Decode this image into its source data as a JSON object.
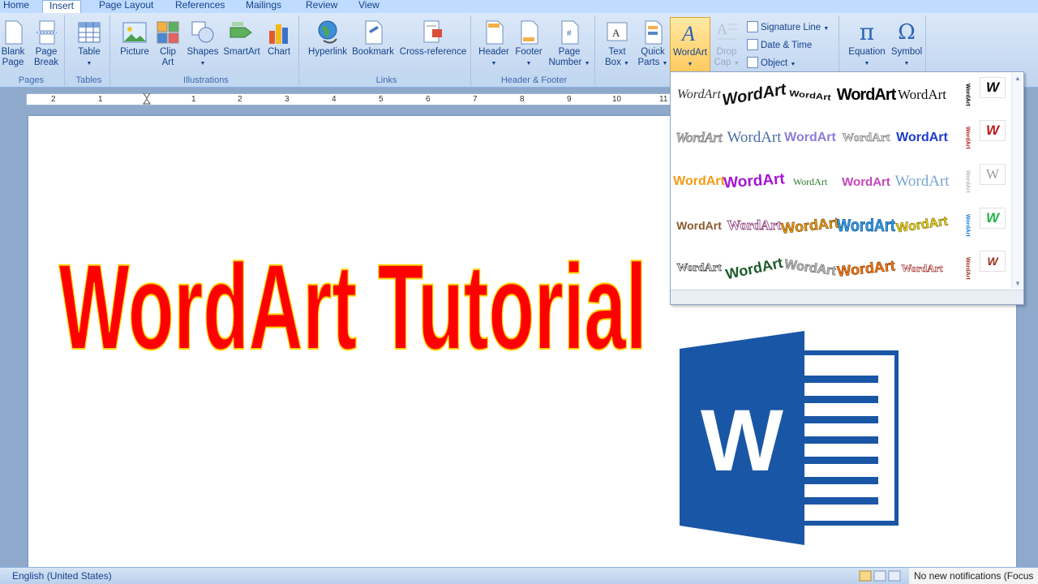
{
  "tabs": [
    "Home",
    "Insert",
    "Page Layout",
    "References",
    "Mailings",
    "Review",
    "View"
  ],
  "active_tab": "Insert",
  "groups": {
    "pages": "Pages",
    "tables": "Tables",
    "illustrations": "Illustrations",
    "links": "Links",
    "header_footer": "Header & Footer",
    "text": ""
  },
  "buttons": {
    "blank_page": [
      "Blank",
      "Page"
    ],
    "page_break": [
      "Page",
      "Break"
    ],
    "table": "Table",
    "picture": "Picture",
    "clip_art": [
      "Clip",
      "Art"
    ],
    "shapes": "Shapes",
    "smartart": "SmartArt",
    "chart": "Chart",
    "hyperlink": "Hyperlink",
    "bookmark": "Bookmark",
    "cross_reference": "Cross-reference",
    "header": "Header",
    "footer": "Footer",
    "page_number": [
      "Page",
      "Number"
    ],
    "text_box": [
      "Text",
      "Box"
    ],
    "quick_parts": [
      "Quick",
      "Parts"
    ],
    "wordart": "WordArt",
    "drop_cap": [
      "Drop",
      "Cap"
    ],
    "signature_line": "Signature Line",
    "date_time": "Date & Time",
    "object": "Object",
    "equation": "Equation",
    "symbol": "Symbol"
  },
  "ruler_numbers": [
    "2",
    "1",
    "1",
    "2",
    "3",
    "4",
    "5",
    "6",
    "7",
    "8",
    "9",
    "10",
    "11"
  ],
  "document": {
    "wordart_text": "WordArt Tutorial",
    "wordart_fill": "#ff0000",
    "wordart_outline": "#ffd400"
  },
  "gallery": {
    "sample_text": "WordArt",
    "vertical_text": "WordArt",
    "w_letter": "W"
  },
  "logo": {
    "letter": "W",
    "color": "#1a56a6"
  },
  "status": {
    "language": "English (United States)",
    "notification": "No new notifications (Focus"
  }
}
